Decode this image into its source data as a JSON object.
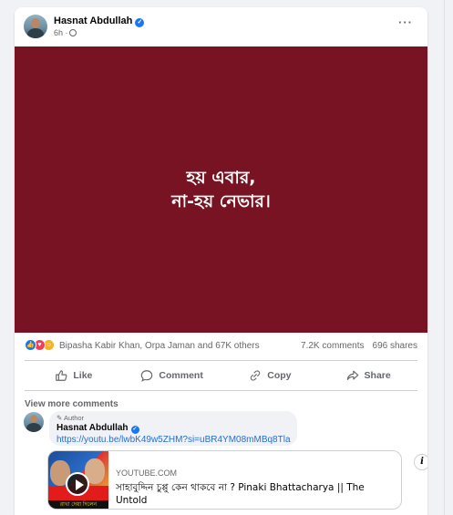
{
  "post": {
    "author": "Hasnat Abdullah",
    "time": "6h ·",
    "image_text": [
      "হয় এবার,",
      "না-হয় নেভার।"
    ],
    "reactors": "Bipasha Kabir Khan, Orpa Jaman and 67K others",
    "comments_count": "7.2K comments",
    "shares_count": "696 shares"
  },
  "actions": {
    "like": "Like",
    "comment": "Comment",
    "copy": "Copy",
    "share": "Share"
  },
  "comments": {
    "view_more": "View more comments",
    "author_badge": "Author",
    "author": "Hasnat Abdullah",
    "link": "https://youtu.be/lwbK49w5ZHM?si=uBR4YM08mMBq8Tla",
    "preview": {
      "domain": "YOUTUBE.COM",
      "title": "সাহাবুদ্দিন চুপ্পু কেন থাকবে না ? Pinaki Bhattacharya || The Untold",
      "thumb_text": "রাখা দেয়া দিলেন"
    }
  },
  "colors": {
    "brand": "#1877f2",
    "post_bg": "#771322",
    "link": "#216fdb"
  }
}
